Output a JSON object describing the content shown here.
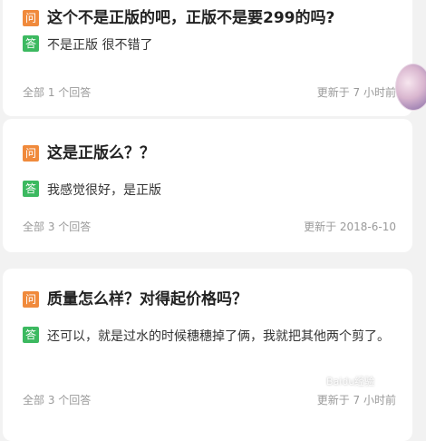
{
  "qa_list": [
    {
      "question_badge": "问",
      "question": "这个不是正版的吧，正版不是要299的吗?",
      "answer_badge": "答",
      "answer": "不是正版 很不错了",
      "answers_count": "全部 1 个回答",
      "updated": "更新于 7 小时前"
    },
    {
      "question_badge": "问",
      "question": "这是正版么？？",
      "answer_badge": "答",
      "answer": "我感觉很好，是正版",
      "answers_count": "全部 3 个回答",
      "updated": "更新于 2018-6-10"
    },
    {
      "question_badge": "问",
      "question": "质量怎么样？对得起价格吗？",
      "answer_badge": "答",
      "answer": "还可以，就是过水的时候穗穗掉了俩，我就把其他两个剪了。",
      "answers_count": "全部 3 个回答",
      "updated": "更新于 7 小时前"
    }
  ],
  "watermark": "Baidu经验"
}
